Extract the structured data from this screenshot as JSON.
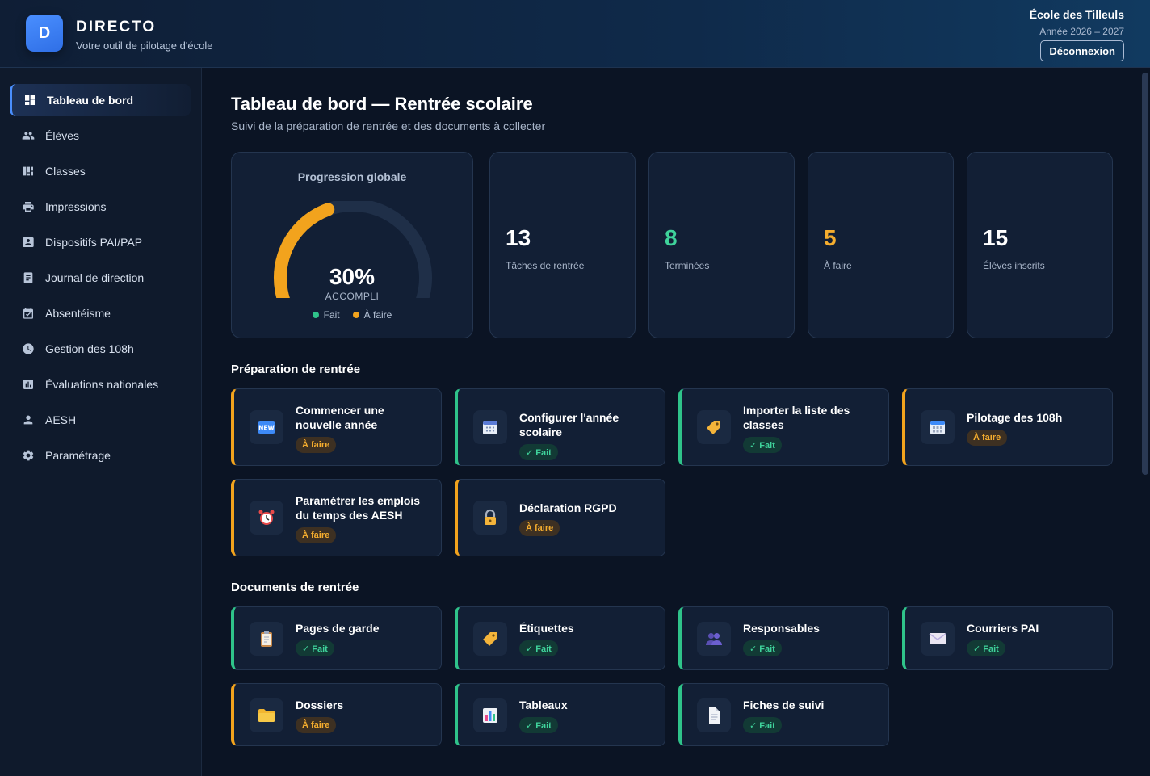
{
  "header": {
    "logo_letter": "D",
    "app_name": "DIRECTO",
    "tagline": "Votre outil de pilotage d'école",
    "school_name": "École des Tilleuls",
    "school_year": "Année 2026 – 2027",
    "logout_label": "Déconnexion"
  },
  "sidebar": {
    "items": [
      {
        "label": "Tableau de bord",
        "icon": "dashboard-icon",
        "active": true
      },
      {
        "label": "Élèves",
        "icon": "people-icon"
      },
      {
        "label": "Classes",
        "icon": "columns-icon"
      },
      {
        "label": "Impressions",
        "icon": "printer-icon"
      },
      {
        "label": "Dispositifs PAI/PAP",
        "icon": "badge-icon"
      },
      {
        "label": "Journal de direction",
        "icon": "notebook-icon"
      },
      {
        "label": "Absentéisme",
        "icon": "calendar-icon"
      },
      {
        "label": "Gestion des 108h",
        "icon": "clock-icon"
      },
      {
        "label": "Évaluations nationales",
        "icon": "bar-chart-icon"
      },
      {
        "label": "AESH",
        "icon": "person-icon"
      },
      {
        "label": "Paramétrage",
        "icon": "gear-icon"
      }
    ]
  },
  "main": {
    "title": "Tableau de bord — Rentrée scolaire",
    "subtitle": "Suivi de la préparation de rentrée et des documents à collecter",
    "gauge": {
      "title": "Progression globale",
      "value_text": "30%",
      "progress_percent": 30,
      "caption": "ACCOMPLI",
      "legend_done": "Fait",
      "legend_todo": "À faire",
      "color_done": "#2fc38a",
      "color_todo": "#f2a31d"
    },
    "stats": [
      {
        "value": "13",
        "label": "Tâches de rentrée",
        "color": "#ffffff"
      },
      {
        "value": "8",
        "label": "Terminées",
        "color": "#3fd39b"
      },
      {
        "value": "5",
        "label": "À faire",
        "color": "#f5ad2e"
      },
      {
        "value": "15",
        "label": "Élèves inscrits",
        "color": "#ffffff"
      }
    ],
    "prep_title": "Préparation de rentrée",
    "prep_tasks": [
      {
        "label": "Commencer une nouvelle année",
        "status": "À faire",
        "icon": "new-icon"
      },
      {
        "label": "Configurer l'année scolaire",
        "status": "Fait",
        "icon": "calendar-spiral-icon"
      },
      {
        "label": "Importer la liste des classes",
        "status": "Fait",
        "icon": "tag-icon"
      },
      {
        "label": "Pilotage des 108h",
        "status": "À faire",
        "icon": "calendar-grid-icon"
      },
      {
        "label": "Paramétrer les emplois du temps des AESH",
        "status": "À faire",
        "icon": "alarm-clock-icon"
      },
      {
        "label": "Déclaration RGPD",
        "status": "À faire",
        "icon": "lock-icon"
      }
    ],
    "docs_title": "Documents de rentrée",
    "doc_tasks": [
      {
        "label": "Pages de garde",
        "status": "Fait",
        "icon": "clipboard-icon"
      },
      {
        "label": "Étiquettes",
        "status": "Fait",
        "icon": "tag-icon"
      },
      {
        "label": "Responsables",
        "status": "Fait",
        "icon": "people-group-icon"
      },
      {
        "label": "Courriers PAI",
        "status": "Fait",
        "icon": "envelope-icon"
      },
      {
        "label": "Dossiers",
        "status": "À faire",
        "icon": "folder-icon"
      },
      {
        "label": "Tableaux",
        "status": "Fait",
        "icon": "chart-icon"
      },
      {
        "label": "Fiches de suivi",
        "status": "Fait",
        "icon": "document-icon"
      }
    ]
  }
}
